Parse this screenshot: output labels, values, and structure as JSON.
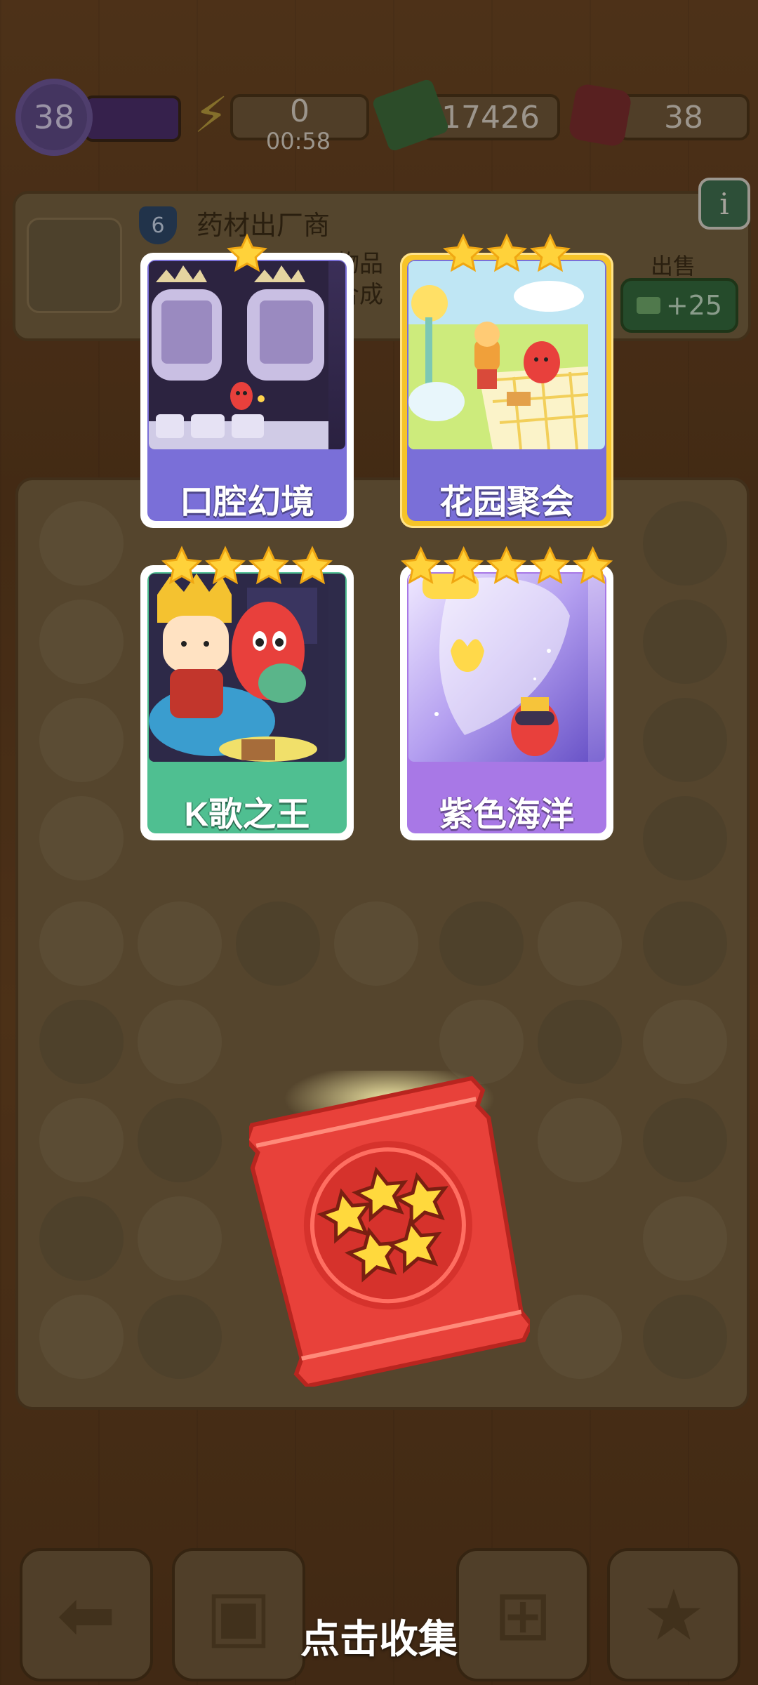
{
  "hud": {
    "level": "38",
    "energy": "0",
    "energy_timer": "00:58",
    "cash": "17426",
    "gems": "38"
  },
  "item_panel": {
    "level": "6",
    "name": "药材出厂商",
    "description_line1": "物品",
    "description_line2": "合成",
    "sell_label": "出售",
    "sell_value": "+25",
    "info_label": "i"
  },
  "cards": [
    {
      "title": "口腔幻境",
      "stars": 1,
      "frame": "purple"
    },
    {
      "title": "花园聚会",
      "stars": 3,
      "frame": "gold-purple"
    },
    {
      "title": "K歌之王",
      "stars": 4,
      "frame": "green"
    },
    {
      "title": "紫色海洋",
      "stars": 5,
      "frame": "violet"
    }
  ],
  "card_pack": {
    "stars": 5,
    "color": "#e8413a"
  },
  "prompt": {
    "collect": "点击收集"
  },
  "bottom_buttons": [
    "back-arrow-icon",
    "backpack-icon",
    "basket-icon",
    "card-album-icon"
  ]
}
